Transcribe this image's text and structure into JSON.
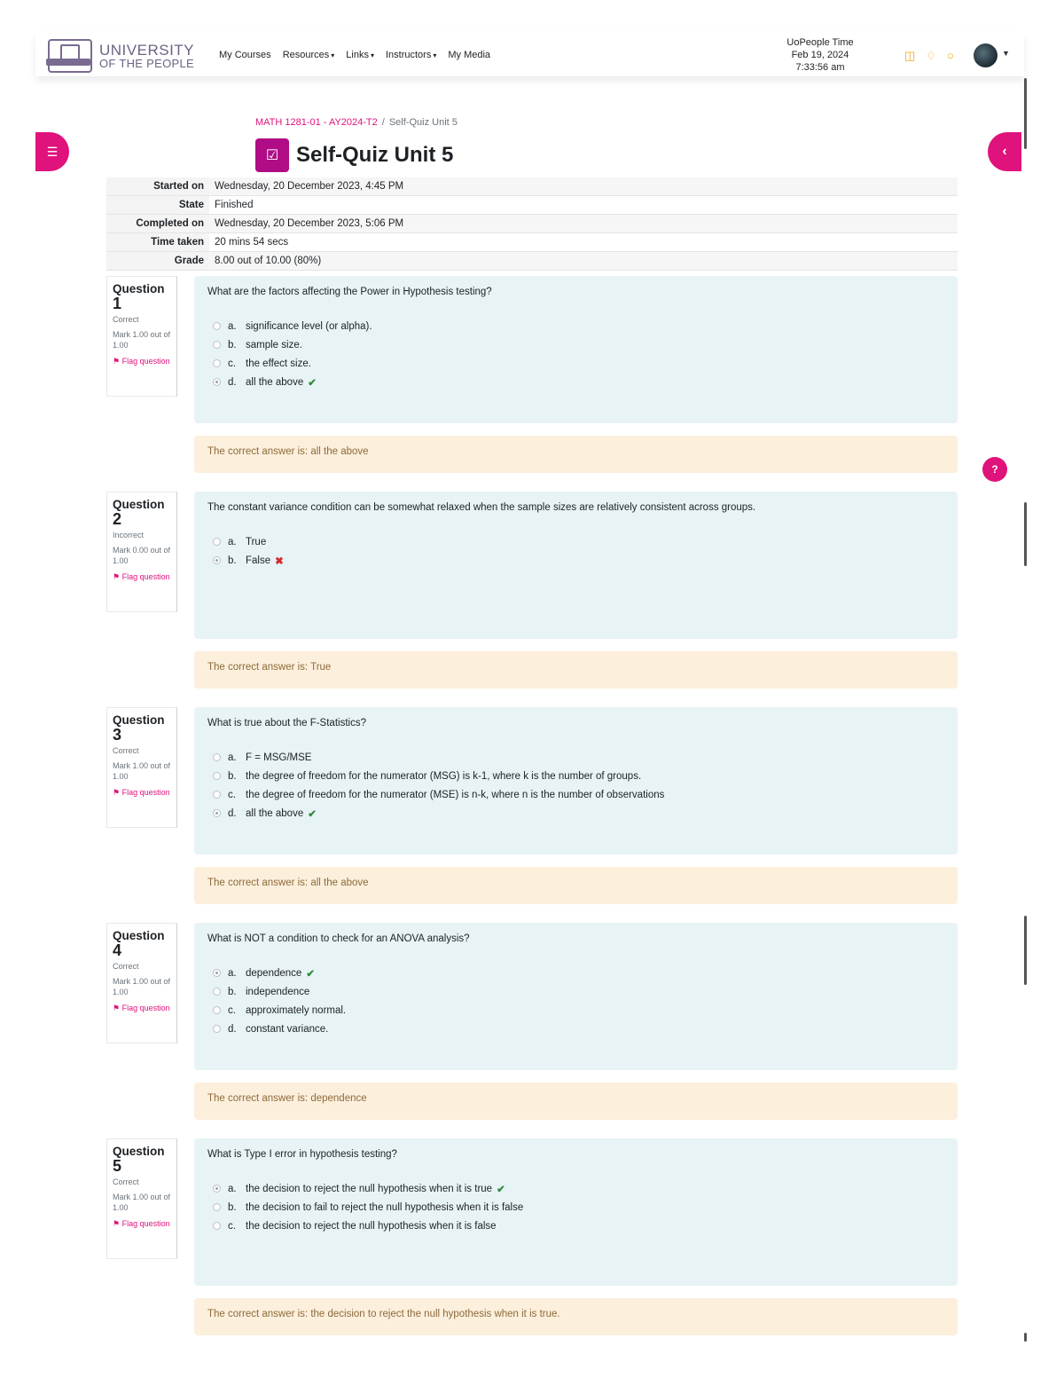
{
  "header": {
    "logo_line1": "UNIVERSITY",
    "logo_line2": "OF THE PEOPLE",
    "logo_badge": "UoPeople",
    "nav": [
      {
        "label": "My Courses",
        "dropdown": false
      },
      {
        "label": "Resources",
        "dropdown": true
      },
      {
        "label": "Links",
        "dropdown": true
      },
      {
        "label": "Instructors",
        "dropdown": true
      },
      {
        "label": "My Media",
        "dropdown": false
      }
    ],
    "time_label": "UoPeople Time",
    "time_date": "Feb 19, 2024",
    "time_clock": "7:33:56 am",
    "icons": [
      "calendar-icon",
      "bell-icon",
      "chat-icon"
    ],
    "accent_color": "#e0127b"
  },
  "breadcrumb": {
    "course": "MATH 1281-01 - AY2024-T2",
    "separator": "/",
    "current": "Self-Quiz Unit 5"
  },
  "page_title": "Self-Quiz Unit 5",
  "summary": [
    {
      "label": "Started on",
      "value": "Wednesday, 20 December 2023, 4:45 PM"
    },
    {
      "label": "State",
      "value": "Finished"
    },
    {
      "label": "Completed on",
      "value": "Wednesday, 20 December 2023, 5:06 PM"
    },
    {
      "label": "Time taken",
      "value": "20 mins 54 secs"
    },
    {
      "label": "Grade",
      "value": "8.00 out of 10.00 (80%)"
    }
  ],
  "question_label": "Question",
  "flag_label": "Flag question",
  "questions": [
    {
      "number": "1",
      "state": "Correct",
      "mark": "Mark 1.00 out of 1.00",
      "text": "What are the factors affecting the Power in Hypothesis testing?",
      "answers": [
        {
          "letter": "a.",
          "text": "significance level (or alpha).",
          "selected": false,
          "result": ""
        },
        {
          "letter": "b.",
          "text": "sample size.",
          "selected": false,
          "result": ""
        },
        {
          "letter": "c.",
          "text": "the effect size.",
          "selected": false,
          "result": ""
        },
        {
          "letter": "d.",
          "text": "all the above",
          "selected": true,
          "result": "correct"
        }
      ],
      "feedback": "The correct answer is: all the above"
    },
    {
      "number": "2",
      "state": "Incorrect",
      "mark": "Mark 0.00 out of 1.00",
      "text": "The constant variance condition can be somewhat relaxed when the sample sizes are relatively consistent across groups.",
      "answers": [
        {
          "letter": "a.",
          "text": "True",
          "selected": false,
          "result": ""
        },
        {
          "letter": "b.",
          "text": "False",
          "selected": true,
          "result": "incorrect"
        }
      ],
      "feedback": "The correct answer is: True"
    },
    {
      "number": "3",
      "state": "Correct",
      "mark": "Mark 1.00 out of 1.00",
      "text": "What is true about the F-Statistics?",
      "answers": [
        {
          "letter": "a.",
          "text": "F = MSG/MSE",
          "selected": false,
          "result": ""
        },
        {
          "letter": "b.",
          "text": "the degree of freedom for the numerator (MSG) is k-1, where k is the number of groups.",
          "selected": false,
          "result": ""
        },
        {
          "letter": "c.",
          "text": "the degree of freedom for the numerator (MSE) is n-k, where n is the number of observations",
          "selected": false,
          "result": ""
        },
        {
          "letter": "d.",
          "text": "all the above",
          "selected": true,
          "result": "correct"
        }
      ],
      "feedback": "The correct answer is: all the above"
    },
    {
      "number": "4",
      "state": "Correct",
      "mark": "Mark 1.00 out of 1.00",
      "text": "What is NOT a condition to check for an ANOVA analysis?",
      "answers": [
        {
          "letter": "a.",
          "text": "dependence",
          "selected": true,
          "result": "correct"
        },
        {
          "letter": "b.",
          "text": "independence",
          "selected": false,
          "result": ""
        },
        {
          "letter": "c.",
          "text": "approximately normal.",
          "selected": false,
          "result": ""
        },
        {
          "letter": "d.",
          "text": "constant variance.",
          "selected": false,
          "result": ""
        }
      ],
      "feedback": "The correct answer is: dependence"
    },
    {
      "number": "5",
      "state": "Correct",
      "mark": "Mark 1.00 out of 1.00",
      "text": "What is Type I error in hypothesis testing?",
      "answers": [
        {
          "letter": "a.",
          "text": "the decision to reject the null hypothesis when it is true",
          "selected": true,
          "result": "correct"
        },
        {
          "letter": "b.",
          "text": "the decision to fail to reject the null hypothesis when it is false",
          "selected": false,
          "result": ""
        },
        {
          "letter": "c.",
          "text": "the decision to reject the null hypothesis when it is false",
          "selected": false,
          "result": ""
        }
      ],
      "feedback": "The correct answer is: the decision to reject the null hypothesis when it is true."
    }
  ]
}
